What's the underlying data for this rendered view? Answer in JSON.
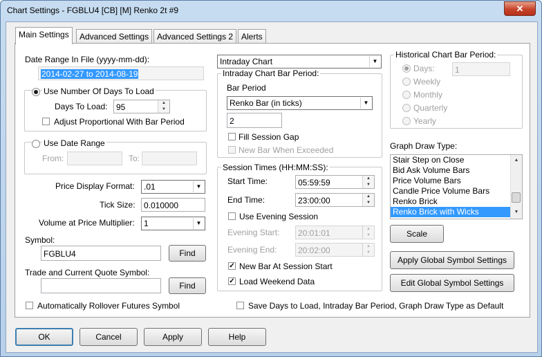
{
  "window": {
    "title": "Chart Settings - FGBLU4 [CB] [M]  Renko 2t  #9",
    "close": "✕"
  },
  "tabs": [
    "Main Settings",
    "Advanced Settings",
    "Advanced Settings 2",
    "Alerts"
  ],
  "left": {
    "date_range_label": "Date Range In File (yyyy-mm-dd):",
    "date_range_value": "2014-02-27 to 2014-08-19",
    "use_days_label": "Use Number Of Days To Load",
    "days_to_load_label": "Days To Load:",
    "days_to_load_value": "95",
    "adjust_label": "Adjust Proportional With Bar Period",
    "use_date_range_label": "Use Date Range",
    "from_label": "From:",
    "to_label": "To:",
    "price_format_label": "Price Display Format:",
    "price_format_value": ".01",
    "tick_size_label": "Tick Size:",
    "tick_size_value": "0.010000",
    "vap_label": "Volume at Price Multiplier:",
    "vap_value": "1",
    "symbol_label": "Symbol:",
    "symbol_value": "FGBLU4",
    "find_label": "Find",
    "trade_symbol_label": "Trade and Current Quote Symbol:",
    "trade_symbol_value": "",
    "auto_rollover_label": "Automatically Rollover Futures Symbol"
  },
  "middle": {
    "chart_type_value": "Intraday Chart",
    "bar_period_group": "Intraday Chart Bar Period:",
    "bar_period_label": "Bar Period",
    "bar_period_value": "Renko Bar (in ticks)",
    "bar_period_num": "2",
    "fill_gap_label": "Fill Session Gap",
    "new_bar_exceeded_label": "New Bar When Exceeded",
    "session_group": "Session Times (HH:MM:SS):",
    "start_time_label": "Start Time:",
    "start_time_value": "05:59:59",
    "end_time_label": "End Time:",
    "end_time_value": "23:00:00",
    "use_evening_label": "Use Evening Session",
    "evening_start_label": "Evening Start:",
    "evening_start_value": "20:01:01",
    "evening_end_label": "Evening End:",
    "evening_end_value": "20:02:00",
    "new_bar_session_label": "New Bar At Session Start",
    "load_weekend_label": "Load Weekend Data",
    "save_default_label": "Save Days to Load, Intraday Bar Period, Graph Draw Type as Default"
  },
  "right": {
    "hist_group": "Historical Chart Bar Period:",
    "days_label": "Days:",
    "days_value": "1",
    "weekly": "Weekly",
    "monthly": "Monthly",
    "quarterly": "Quarterly",
    "yearly": "Yearly",
    "graph_draw_label": "Graph Draw Type:",
    "draw_types": [
      "Stair Step on Close",
      "Bid Ask Volume Bars",
      "Price Volume Bars",
      "Candle Price Volume Bars",
      "Renko Brick",
      "Renko Brick with Wicks"
    ],
    "scale_label": "Scale",
    "apply_global_label": "Apply Global Symbol Settings",
    "edit_global_label": "Edit Global Symbol Settings"
  },
  "footer": {
    "ok": "OK",
    "cancel": "Cancel",
    "apply": "Apply",
    "help": "Help"
  },
  "colors": {
    "selection": "#3399ff",
    "title_gradient": "#c7dcf0",
    "close_button": "#c7442a"
  },
  "icons": {
    "check": "✓",
    "down": "▼",
    "up": "▲",
    "close": "close-icon"
  }
}
